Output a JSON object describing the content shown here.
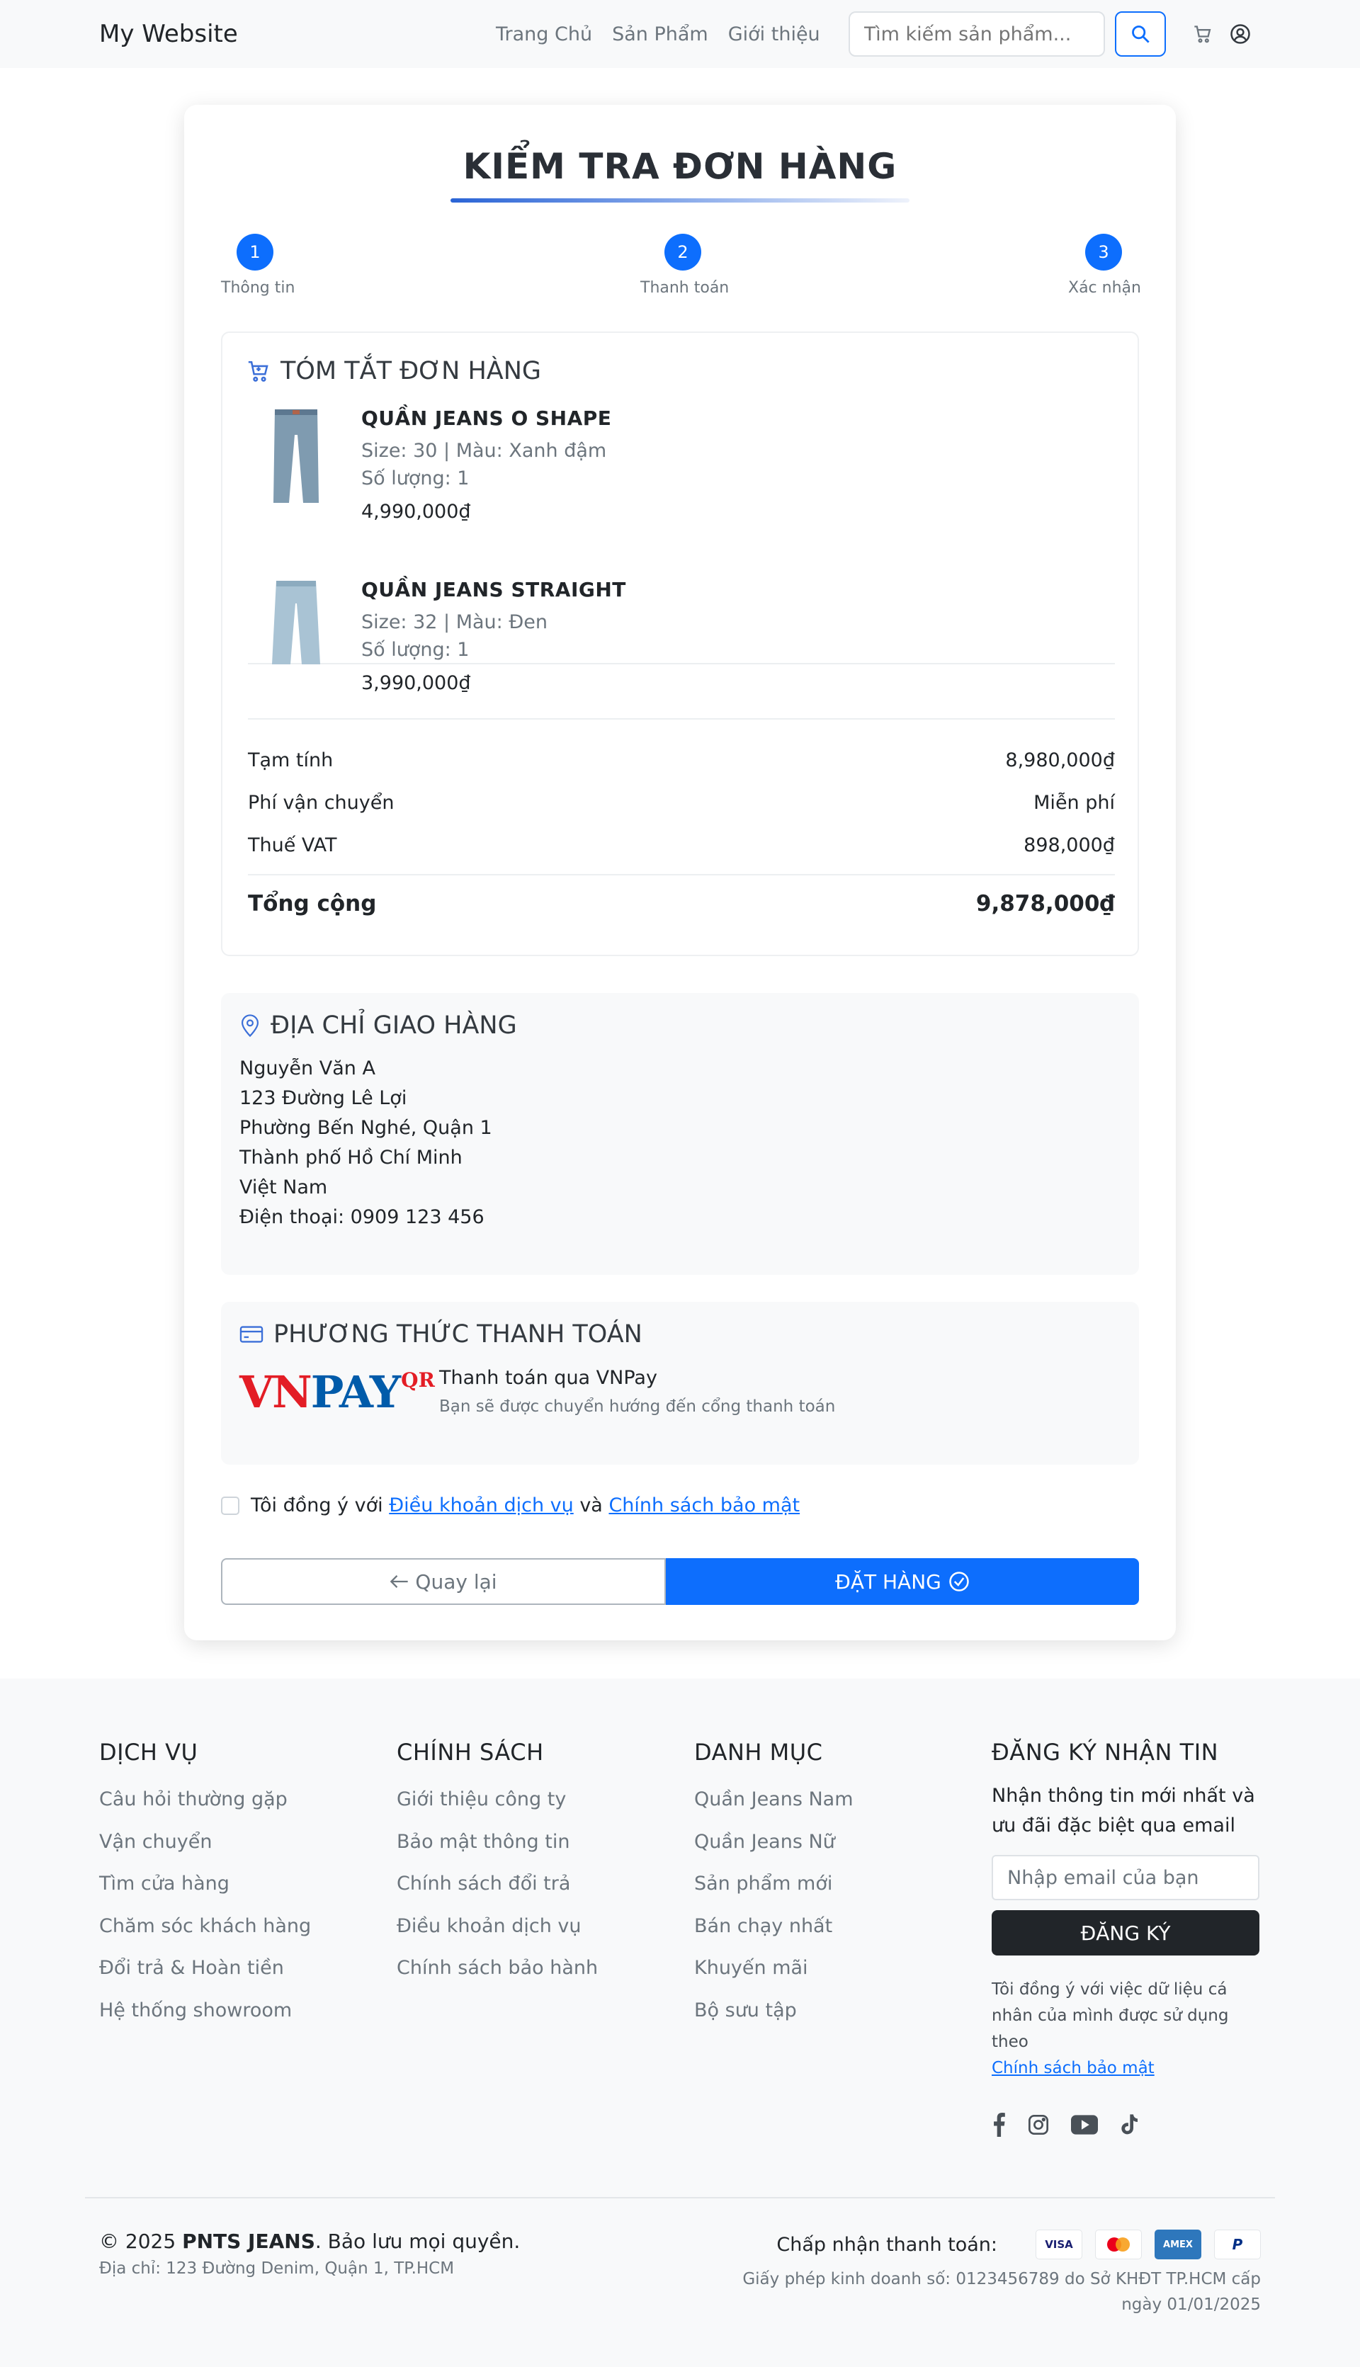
{
  "header": {
    "brand": "My Website",
    "nav": [
      "Trang Chủ",
      "Sản Phẩm",
      "Giới thiệu"
    ],
    "search_placeholder": "Tìm kiếm sản phẩm..."
  },
  "checkout": {
    "title": "KIỂM TRA ĐƠN HÀNG",
    "steps": [
      {
        "number": "1",
        "label": "Thông tin"
      },
      {
        "number": "2",
        "label": "Thanh toán"
      },
      {
        "number": "3",
        "label": "Xác nhận"
      }
    ],
    "summary": {
      "title": "TÓM TẮT ĐƠN HÀNG",
      "items": [
        {
          "name": "QUẦN JEANS O SHAPE",
          "variant": "Size: 30 | Màu: Xanh đậm",
          "quantity": "Số lượng: 1",
          "price": "4,990,000₫"
        },
        {
          "name": "QUẦN JEANS STRAIGHT",
          "variant": "Size: 32 | Màu: Đen",
          "quantity": "Số lượng: 1",
          "price": "3,990,000₫"
        }
      ],
      "subtotal_label": "Tạm tính",
      "subtotal_value": "8,980,000₫",
      "shipping_label": "Phí vận chuyển",
      "shipping_value": "Miễn phí",
      "vat_label": "Thuế VAT",
      "vat_value": "898,000₫",
      "total_label": "Tổng cộng",
      "total_value": "9,878,000₫"
    },
    "address": {
      "title": "ĐỊA CHỈ GIAO HÀNG",
      "lines": [
        "Nguyễn Văn A",
        "123 Đường Lê Lợi",
        "Phường Bến Nghé, Quận 1",
        "Thành phố Hồ Chí Minh",
        "Việt Nam",
        "Điện thoại: 0909 123 456"
      ]
    },
    "payment": {
      "title": "PHƯƠNG THỨC THANH TOÁN",
      "logo_vn": "VN",
      "logo_pay": "PAY",
      "logo_qr": "QR",
      "method": "Thanh toán qua VNPay",
      "note": "Bạn sẽ được chuyển hướng đến cổng thanh toán"
    },
    "agree": {
      "prefix": "Tôi đồng ý với",
      "terms": "Điều khoản dịch vụ",
      "and": "và",
      "privacy": "Chính sách bảo mật"
    },
    "back_label": "Quay lại",
    "order_label": "ĐẶT HÀNG"
  },
  "footer": {
    "columns": [
      {
        "title": "DỊCH VỤ",
        "links": [
          "Câu hỏi thường gặp",
          "Vận chuyển",
          "Tìm cửa hàng",
          "Chăm sóc khách hàng",
          "Đổi trả & Hoàn tiền",
          "Hệ thống showroom"
        ]
      },
      {
        "title": "CHÍNH SÁCH",
        "links": [
          "Giới thiệu công ty",
          "Bảo mật thông tin",
          "Chính sách đổi trả",
          "Điều khoản dịch vụ",
          "Chính sách bảo hành"
        ]
      },
      {
        "title": "DANH MỤC",
        "links": [
          "Quần Jeans Nam",
          "Quần Jeans Nữ",
          "Sản phẩm mới",
          "Bán chạy nhất",
          "Khuyến mãi",
          "Bộ sưu tập"
        ]
      }
    ],
    "newsletter": {
      "title": "ĐĂNG KÝ NHẬN TIN",
      "text": "Nhận thông tin mới nhất và ưu đãi đặc biệt qua email",
      "placeholder": "Nhập email của bạn",
      "button": "ĐĂNG KÝ",
      "consent": "Tôi đồng ý với việc dữ liệu cá nhân của mình được sử dụng theo",
      "consent_link": "Chính sách bảo mật"
    },
    "copyright_prefix": "© 2025",
    "copyright_brand": "PNTS JEANS",
    "copyright_suffix": ". Bảo lưu mọi quyền.",
    "address": "Địa chỉ: 123 Đường Denim, Quận 1, TP.HCM",
    "accept_label": "Chấp nhận thanh toán:",
    "card_visa": "VISA",
    "card_amex": "AMEX",
    "card_paypal": "P",
    "license": "Giấy phép kinh doanh số: 0123456789 do Sở KHĐT TP.HCM cấp ngày 01/01/2025"
  },
  "colors": {
    "primary": "#0d6efd",
    "dark": "#212529",
    "muted": "#6c757d",
    "vnpay_blue": "#005baa",
    "vnpay_red": "#e31d25"
  }
}
